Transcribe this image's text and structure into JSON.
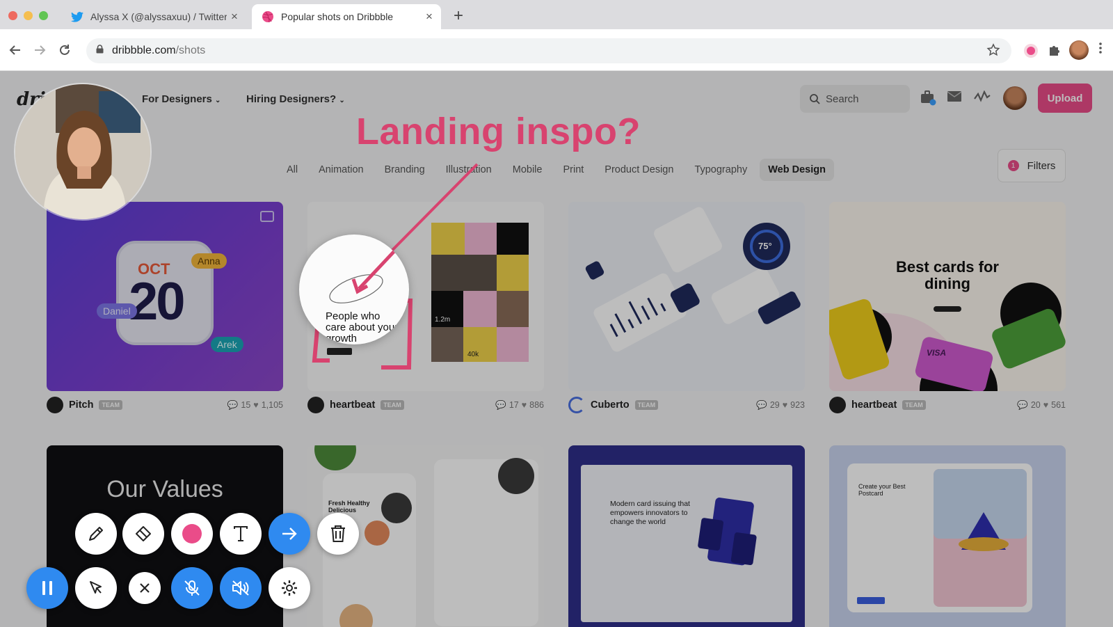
{
  "browser": {
    "tabs": [
      {
        "title": "Alyssa X (@alyssaxuu) / Twitter",
        "icon": "twitter-bird-icon"
      },
      {
        "title": "Popular shots on Dribbble",
        "icon": "dribbble-ball-icon"
      }
    ],
    "url_host": "dribbble.com",
    "url_path": "/shots"
  },
  "header": {
    "logo": "dri",
    "nav": [
      "For Designers",
      "Hiring Designers?"
    ],
    "search_placeholder": "Search",
    "upload_label": "Upload"
  },
  "categories": [
    "All",
    "Animation",
    "Branding",
    "Illustration",
    "Mobile",
    "Print",
    "Product Design",
    "Typography",
    "Web Design"
  ],
  "active_category": "Web Design",
  "filters": {
    "label": "Filters",
    "count": "1"
  },
  "annotation": {
    "title": "Landing inspo?"
  },
  "shots": [
    {
      "author": "Pitch",
      "badge": "TEAM",
      "comments": "15",
      "likes": "1,105",
      "avatar_label": "Pitch",
      "art": {
        "month": "OCT",
        "day": "20",
        "tags": [
          "Anna",
          "Daniel",
          "Arek"
        ]
      }
    },
    {
      "author": "heartbeat",
      "badge": "TEAM",
      "comments": "17",
      "likes": "886",
      "art": {
        "headline": "People who care about your growth",
        "stat1": "1.2m",
        "stat2": "40k"
      }
    },
    {
      "author": "Cuberto",
      "badge": "TEAM",
      "comments": "29",
      "likes": "923",
      "art": {
        "gauge": "75°"
      }
    },
    {
      "author": "heartbeat",
      "badge": "TEAM",
      "comments": "20",
      "likes": "561",
      "art": {
        "headline": "Best cards for dining",
        "card_brand": "VISA"
      }
    }
  ],
  "shots_row2": [
    {
      "art_title": "Our Values"
    },
    {
      "art_title": "Fresh Healthy Delicious"
    },
    {
      "art_title": "Modern card issuing that empowers innovators to change the world"
    },
    {
      "art_title": "Create your Best Postcard"
    }
  ],
  "colors": {
    "brand_pink": "#ea4c89",
    "annotation_pink": "#d8436f",
    "toolbar_blue": "#2f8af0"
  },
  "toolbar": {
    "row1": [
      "pencil-icon",
      "eraser-icon",
      "color-dot-icon",
      "text-icon",
      "arrow-icon",
      "trash-icon"
    ],
    "row2": [
      "pause-icon",
      "cursor-icon",
      "close-icon",
      "mic-off-icon",
      "speaker-off-icon",
      "gear-icon"
    ]
  }
}
